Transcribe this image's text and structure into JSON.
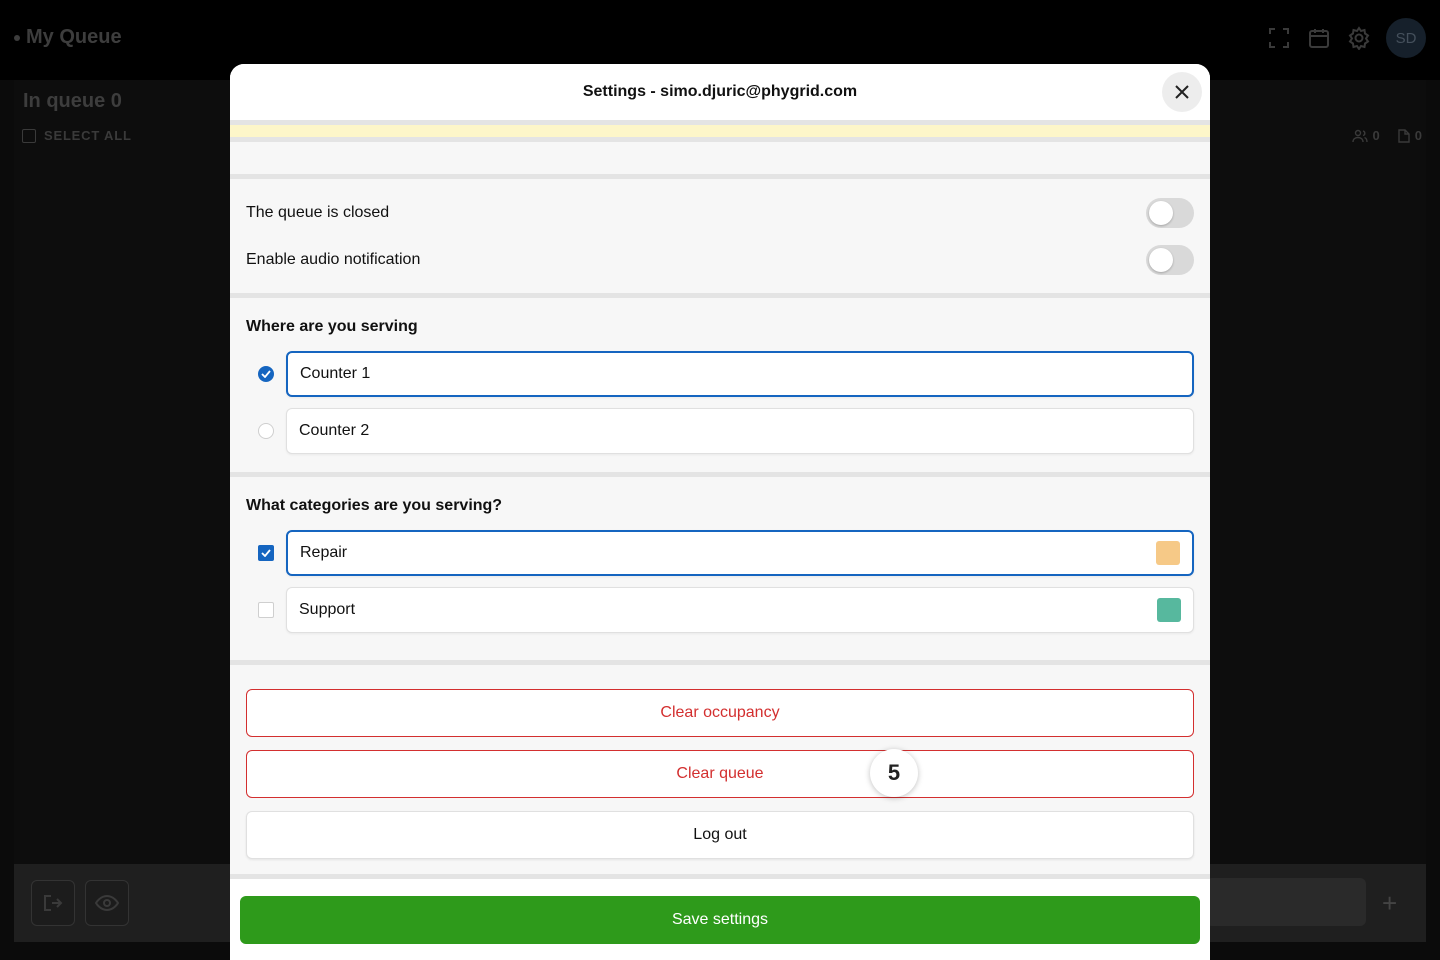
{
  "background": {
    "app_title": "My Queue",
    "in_queue_label": "In queue 0",
    "select_all_label": "SELECT ALL",
    "people_count": "0",
    "docs_count": "0",
    "avatar_initials": "SD",
    "icons": [
      "fullscreen-icon",
      "calendar-icon",
      "gear-icon",
      "exit-icon",
      "eye-icon",
      "plus-icon"
    ]
  },
  "modal": {
    "title": "Settings - simo.djuric@phygrid.com",
    "toggles": [
      {
        "label": "The queue is closed",
        "on": false
      },
      {
        "label": "Enable audio notification",
        "on": false
      }
    ],
    "serving": {
      "title": "Where are you serving",
      "options": [
        {
          "label": "Counter 1",
          "selected": true
        },
        {
          "label": "Counter 2",
          "selected": false
        }
      ]
    },
    "categories": {
      "title": "What categories are you serving?",
      "options": [
        {
          "label": "Repair",
          "checked": true,
          "color": "#f6c987"
        },
        {
          "label": "Support",
          "checked": false,
          "color": "#57b89e"
        }
      ]
    },
    "actions": {
      "clear_occupancy": "Clear occupancy",
      "clear_queue": "Clear queue",
      "log_out": "Log out"
    },
    "save_label": "Save settings"
  },
  "step_badge": "5",
  "colors": {
    "accent": "#1565c0",
    "danger": "#d32f2f",
    "save": "#2e9a1b",
    "notice": "#fdf6c9"
  }
}
